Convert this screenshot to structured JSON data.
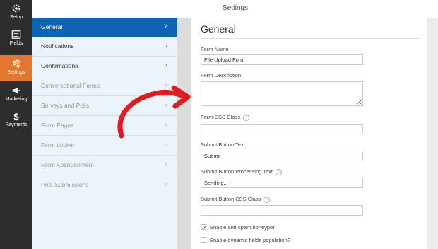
{
  "leftbar": {
    "items": [
      {
        "label": "Setup",
        "icon": "gear-icon"
      },
      {
        "label": "Fields",
        "icon": "list-icon"
      },
      {
        "label": "Settings",
        "icon": "sliders-icon"
      },
      {
        "label": "Marketing",
        "icon": "megaphone-icon"
      },
      {
        "label": "Payments",
        "icon": "dollar-icon"
      }
    ],
    "active_color": "#e27730"
  },
  "header": {
    "title": "Settings"
  },
  "panel": {
    "items": [
      {
        "label": "General",
        "chevron": "˅"
      },
      {
        "label": "Notifications",
        "chevron": "›"
      },
      {
        "label": "Confirmations",
        "chevron": "›"
      },
      {
        "label": "Conversational Forms",
        "chevron": "›"
      },
      {
        "label": "Surveys and Polls",
        "chevron": "›"
      },
      {
        "label": "Form Pages",
        "chevron": "›"
      },
      {
        "label": "Form Locker",
        "chevron": "›"
      },
      {
        "label": "Form Abandonment",
        "chevron": "›"
      },
      {
        "label": "Post Submissions",
        "chevron": "›"
      }
    ],
    "active_color": "#0e63b3"
  },
  "content": {
    "title": "General",
    "form_name": {
      "label": "Form Name",
      "value": "File Upload Form"
    },
    "form_description": {
      "label": "Form Description",
      "value": ""
    },
    "css_class": {
      "label": "Form CSS Class",
      "value": ""
    },
    "submit_text": {
      "label": "Submit Button Text",
      "value": "Submit"
    },
    "processing_text": {
      "label": "Submit Button Processing Text",
      "value": "Sending..."
    },
    "submit_css": {
      "label": "Submit Button CSS Class",
      "value": ""
    },
    "antispam": {
      "label": "Enable anti-spam honeypot",
      "checked": true
    },
    "dynamic": {
      "label": "Enable dynamic fields population",
      "checked": false
    }
  },
  "annotation": {
    "arrow_color": "#e01b24"
  }
}
